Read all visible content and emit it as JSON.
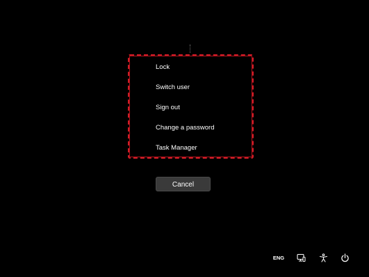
{
  "menu": {
    "items": [
      {
        "label": "Lock"
      },
      {
        "label": "Switch user"
      },
      {
        "label": "Sign out"
      },
      {
        "label": "Change a password"
      },
      {
        "label": "Task Manager"
      }
    ],
    "highlight_color": "#d01c26"
  },
  "cancel_label": "Cancel",
  "tray": {
    "language": "ENG",
    "network_icon": "network-icon",
    "accessibility_icon": "accessibility-icon",
    "power_icon": "power-icon"
  },
  "colors": {
    "background": "#000000",
    "button": "#3a3a3a",
    "text": "#ffffff"
  }
}
